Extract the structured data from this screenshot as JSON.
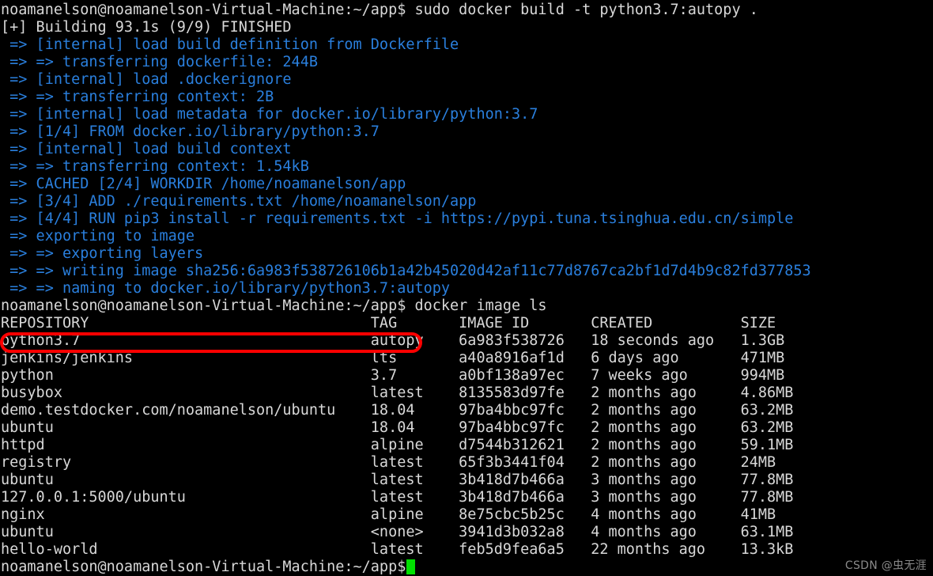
{
  "terminal": {
    "background_color": "#000000",
    "default_text_color": "#d8d8d8",
    "build_output_color": "#2a7fdd",
    "cursor_color": "#00e000",
    "highlight_color": "#fe0000",
    "prompt": "noamanelson@noamanelson-Virtual-Machine:~/app$",
    "lines": [
      {
        "kind": "prompt",
        "text": "noamanelson@noamanelson-Virtual-Machine:~/app$ sudo docker build -t python3.7:autopy ."
      },
      {
        "kind": "output",
        "text": "[+] Building 93.1s (9/9) FINISHED"
      },
      {
        "kind": "build",
        "text": " => [internal] load build definition from Dockerfile"
      },
      {
        "kind": "build",
        "text": " => => transferring dockerfile: 244B"
      },
      {
        "kind": "build",
        "text": " => [internal] load .dockerignore"
      },
      {
        "kind": "build",
        "text": " => => transferring context: 2B"
      },
      {
        "kind": "build",
        "text": " => [internal] load metadata for docker.io/library/python:3.7"
      },
      {
        "kind": "build",
        "text": " => [1/4] FROM docker.io/library/python:3.7"
      },
      {
        "kind": "build",
        "text": " => [internal] load build context"
      },
      {
        "kind": "build",
        "text": " => => transferring context: 1.54kB"
      },
      {
        "kind": "build",
        "text": " => CACHED [2/4] WORKDIR /home/noamanelson/app"
      },
      {
        "kind": "build",
        "text": " => [3/4] ADD ./requirements.txt /home/noamanelson/app"
      },
      {
        "kind": "build",
        "text": " => [4/4] RUN pip3 install -r requirements.txt -i https://pypi.tuna.tsinghua.edu.cn/simple"
      },
      {
        "kind": "build",
        "text": " => exporting to image"
      },
      {
        "kind": "build",
        "text": " => => exporting layers"
      },
      {
        "kind": "build",
        "text": " => => writing image sha256:6a983f538726106b1a42b45020d42af11c77d8767ca2bf1d7d4b9c82fd377853"
      },
      {
        "kind": "build",
        "text": " => => naming to docker.io/library/python3.7:autopy"
      },
      {
        "kind": "prompt",
        "text": "noamanelson@noamanelson-Virtual-Machine:~/app$ docker image ls"
      }
    ]
  },
  "image_table": {
    "command": "docker image ls",
    "columns": [
      "REPOSITORY",
      "TAG",
      "IMAGE ID",
      "CREATED",
      "SIZE"
    ],
    "column_starts": [
      0,
      42,
      52,
      67,
      84
    ],
    "rows": [
      {
        "repository": "python3.7",
        "tag": "autopy",
        "image_id": "6a983f538726",
        "created": "18 seconds ago",
        "size": "1.3GB",
        "highlighted": true
      },
      {
        "repository": "jenkins/jenkins",
        "tag": "lts",
        "image_id": "a40a8916af1d",
        "created": "6 days ago",
        "size": "471MB",
        "highlighted": false
      },
      {
        "repository": "python",
        "tag": "3.7",
        "image_id": "a0bf138a97ec",
        "created": "7 weeks ago",
        "size": "994MB",
        "highlighted": false
      },
      {
        "repository": "busybox",
        "tag": "latest",
        "image_id": "8135583d97fe",
        "created": "2 months ago",
        "size": "4.86MB",
        "highlighted": false
      },
      {
        "repository": "demo.testdocker.com/noamanelson/ubuntu",
        "tag": "18.04",
        "image_id": "97ba4bbc97fc",
        "created": "2 months ago",
        "size": "63.2MB",
        "highlighted": false
      },
      {
        "repository": "ubuntu",
        "tag": "18.04",
        "image_id": "97ba4bbc97fc",
        "created": "2 months ago",
        "size": "63.2MB",
        "highlighted": false
      },
      {
        "repository": "httpd",
        "tag": "alpine",
        "image_id": "d7544b312621",
        "created": "2 months ago",
        "size": "59.1MB",
        "highlighted": false
      },
      {
        "repository": "registry",
        "tag": "latest",
        "image_id": "65f3b3441f04",
        "created": "2 months ago",
        "size": "24MB",
        "highlighted": false
      },
      {
        "repository": "ubuntu",
        "tag": "latest",
        "image_id": "3b418d7b466a",
        "created": "3 months ago",
        "size": "77.8MB",
        "highlighted": false
      },
      {
        "repository": "127.0.0.1:5000/ubuntu",
        "tag": "latest",
        "image_id": "3b418d7b466a",
        "created": "3 months ago",
        "size": "77.8MB",
        "highlighted": false
      },
      {
        "repository": "nginx",
        "tag": "alpine",
        "image_id": "8e75cbc5b25c",
        "created": "4 months ago",
        "size": "41MB",
        "highlighted": false
      },
      {
        "repository": "ubuntu",
        "tag": "<none>",
        "image_id": "3941d3b032a8",
        "created": "4 months ago",
        "size": "63.1MB",
        "highlighted": false
      },
      {
        "repository": "hello-world",
        "tag": "latest",
        "image_id": "feb5d9fea6a5",
        "created": "22 months ago",
        "size": "13.3kB",
        "highlighted": false
      }
    ]
  },
  "final_prompt": {
    "text": "noamanelson@noamanelson-Virtual-Machine:~/app$",
    "cursor": "block"
  },
  "watermark": {
    "text": "CSDN @虫无涯"
  }
}
